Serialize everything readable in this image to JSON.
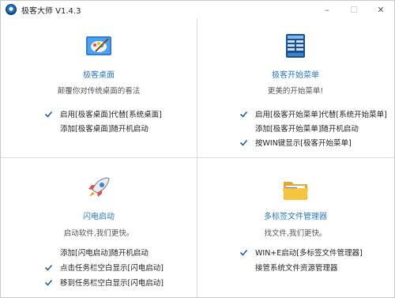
{
  "window": {
    "title": "极客大师 V1.4.3",
    "controls": {
      "minimize": "–",
      "maximize": "☐",
      "close": "✕"
    }
  },
  "panels": [
    {
      "title": "极客桌面",
      "subtitle": "颠覆你对传统桌面的看法",
      "icon": "desktop-paint-icon",
      "options": [
        {
          "label": "启用[极客桌面]代替[系统桌面]",
          "checked": true
        },
        {
          "label": "添加[极客桌面]随开机启动",
          "checked": false
        }
      ]
    },
    {
      "title": "极客开始菜单",
      "subtitle": "更美的开始菜单!",
      "icon": "start-menu-icon",
      "options": [
        {
          "label": "启用[极客开始菜单]代替[系统开始菜单]",
          "checked": true
        },
        {
          "label": "添加[极客开始菜单]随开机启动",
          "checked": false
        },
        {
          "label": "按WIN键显示[极客开始菜单]",
          "checked": true
        }
      ]
    },
    {
      "title": "闪电启动",
      "subtitle": "启动软件,我们更快。",
      "icon": "rocket-icon",
      "options": [
        {
          "label": "添加[闪电启动]随开机启动",
          "checked": false
        },
        {
          "label": "点击任务栏空白显示[闪电启动]",
          "checked": true
        },
        {
          "label": "移到任务栏空白显示[闪电启动]",
          "checked": true
        }
      ]
    },
    {
      "title": "多标签文件管理器",
      "subtitle": "找文件,我们更快。",
      "icon": "folder-icon",
      "options": [
        {
          "label": "WIN+E启动[多标签文件管理器]",
          "checked": true
        },
        {
          "label": "接管系统文件资源管理器",
          "checked": false
        }
      ]
    }
  ],
  "colors": {
    "accent": "#2c78c8",
    "check": "#1f5fa8"
  }
}
